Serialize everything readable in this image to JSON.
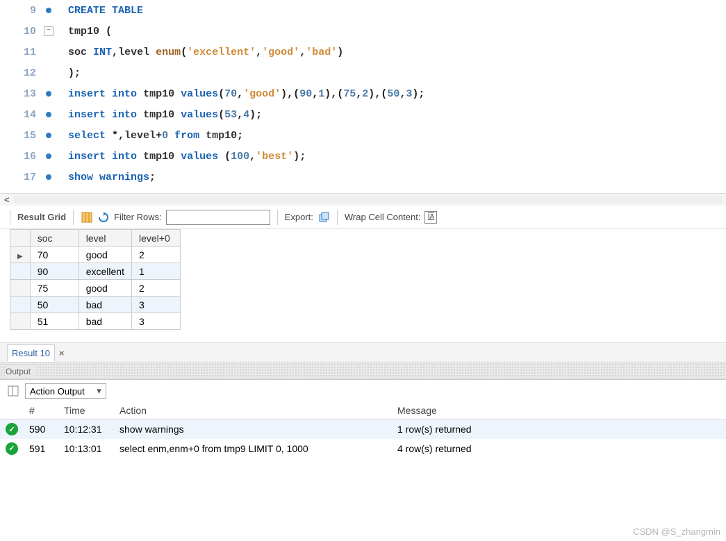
{
  "editor": {
    "lines": [
      {
        "num": 9,
        "marker": "dot",
        "tokens": [
          [
            "kw",
            "CREATE"
          ],
          [
            "sp",
            " "
          ],
          [
            "kw",
            "TABLE"
          ]
        ]
      },
      {
        "num": 10,
        "marker": "fold",
        "tokens": [
          [
            "id",
            "tmp10"
          ],
          [
            "sp",
            " "
          ],
          [
            "punc",
            "("
          ]
        ]
      },
      {
        "num": 11,
        "marker": "",
        "tokens": [
          [
            "id",
            "soc"
          ],
          [
            "sp",
            " "
          ],
          [
            "ty",
            "INT"
          ],
          [
            "punc",
            ","
          ],
          [
            "id",
            "level"
          ],
          [
            "sp",
            " "
          ],
          [
            "fn",
            "enum"
          ],
          [
            "punc",
            "("
          ],
          [
            "str",
            "'excellent'"
          ],
          [
            "punc",
            ","
          ],
          [
            "str",
            "'good'"
          ],
          [
            "punc",
            ","
          ],
          [
            "str",
            "'bad'"
          ],
          [
            "punc",
            ")"
          ]
        ]
      },
      {
        "num": 12,
        "marker": "",
        "tokens": [
          [
            "punc",
            ");"
          ]
        ]
      },
      {
        "num": 13,
        "marker": "dot",
        "tokens": [
          [
            "kw",
            "insert"
          ],
          [
            "sp",
            " "
          ],
          [
            "kw",
            "into"
          ],
          [
            "sp",
            " "
          ],
          [
            "id",
            "tmp10"
          ],
          [
            "sp",
            " "
          ],
          [
            "kw",
            "values"
          ],
          [
            "punc",
            "("
          ],
          [
            "num",
            "70"
          ],
          [
            "punc",
            ","
          ],
          [
            "str",
            "'good'"
          ],
          [
            "punc",
            "),("
          ],
          [
            "num",
            "90"
          ],
          [
            "punc",
            ","
          ],
          [
            "num",
            "1"
          ],
          [
            "punc",
            "),("
          ],
          [
            "num",
            "75"
          ],
          [
            "punc",
            ","
          ],
          [
            "num",
            "2"
          ],
          [
            "punc",
            "),("
          ],
          [
            "num",
            "50"
          ],
          [
            "punc",
            ","
          ],
          [
            "num",
            "3"
          ],
          [
            "punc",
            ");"
          ]
        ]
      },
      {
        "num": 14,
        "marker": "dot",
        "tokens": [
          [
            "kw",
            "insert"
          ],
          [
            "sp",
            " "
          ],
          [
            "kw",
            "into"
          ],
          [
            "sp",
            " "
          ],
          [
            "id",
            "tmp10"
          ],
          [
            "sp",
            " "
          ],
          [
            "kw",
            "values"
          ],
          [
            "punc",
            "("
          ],
          [
            "num",
            "53"
          ],
          [
            "punc",
            ","
          ],
          [
            "num",
            "4"
          ],
          [
            "punc",
            ");"
          ]
        ]
      },
      {
        "num": 15,
        "marker": "dot",
        "tokens": [
          [
            "kw",
            "select"
          ],
          [
            "sp",
            " "
          ],
          [
            "punc",
            "*,"
          ],
          [
            "id",
            "level"
          ],
          [
            "punc",
            "+"
          ],
          [
            "num",
            "0"
          ],
          [
            "sp",
            " "
          ],
          [
            "kw",
            "from"
          ],
          [
            "sp",
            " "
          ],
          [
            "id",
            "tmp10"
          ],
          [
            "punc",
            ";"
          ]
        ]
      },
      {
        "num": 16,
        "marker": "dot",
        "tokens": [
          [
            "kw",
            "insert"
          ],
          [
            "sp",
            " "
          ],
          [
            "kw",
            "into"
          ],
          [
            "sp",
            " "
          ],
          [
            "id",
            "tmp10"
          ],
          [
            "sp",
            " "
          ],
          [
            "kw",
            "values"
          ],
          [
            "sp",
            " "
          ],
          [
            "punc",
            "("
          ],
          [
            "num",
            "100"
          ],
          [
            "punc",
            ","
          ],
          [
            "str",
            "'best'"
          ],
          [
            "punc",
            ");"
          ]
        ]
      },
      {
        "num": 17,
        "marker": "dot",
        "tokens": [
          [
            "kw",
            "show"
          ],
          [
            "sp",
            " "
          ],
          [
            "kw",
            "warnings"
          ],
          [
            "punc",
            ";"
          ]
        ]
      }
    ]
  },
  "grid_toolbar": {
    "label": "Result Grid",
    "filter_label": "Filter Rows:",
    "export_label": "Export:",
    "wrap_label": "Wrap Cell Content:"
  },
  "result_grid": {
    "columns": [
      "soc",
      "level",
      "level+0"
    ],
    "rows": [
      [
        "70",
        "good",
        "2"
      ],
      [
        "90",
        "excellent",
        "1"
      ],
      [
        "75",
        "good",
        "2"
      ],
      [
        "50",
        "bad",
        "3"
      ],
      [
        "51",
        "bad",
        "3"
      ]
    ]
  },
  "result_tab": {
    "label": "Result 10"
  },
  "output": {
    "header": "Output",
    "select": "Action Output",
    "columns": [
      "",
      "#",
      "Time",
      "Action",
      "Message"
    ],
    "rows": [
      {
        "status": "ok",
        "num": "590",
        "time": "10:12:31",
        "action": "show warnings",
        "message": "1 row(s) returned"
      },
      {
        "status": "ok",
        "num": "591",
        "time": "10:13:01",
        "action": "select enm,enm+0 from tmp9 LIMIT 0, 1000",
        "message": "4 row(s) returned"
      }
    ]
  },
  "watermark": "CSDN @S_zhangmin"
}
